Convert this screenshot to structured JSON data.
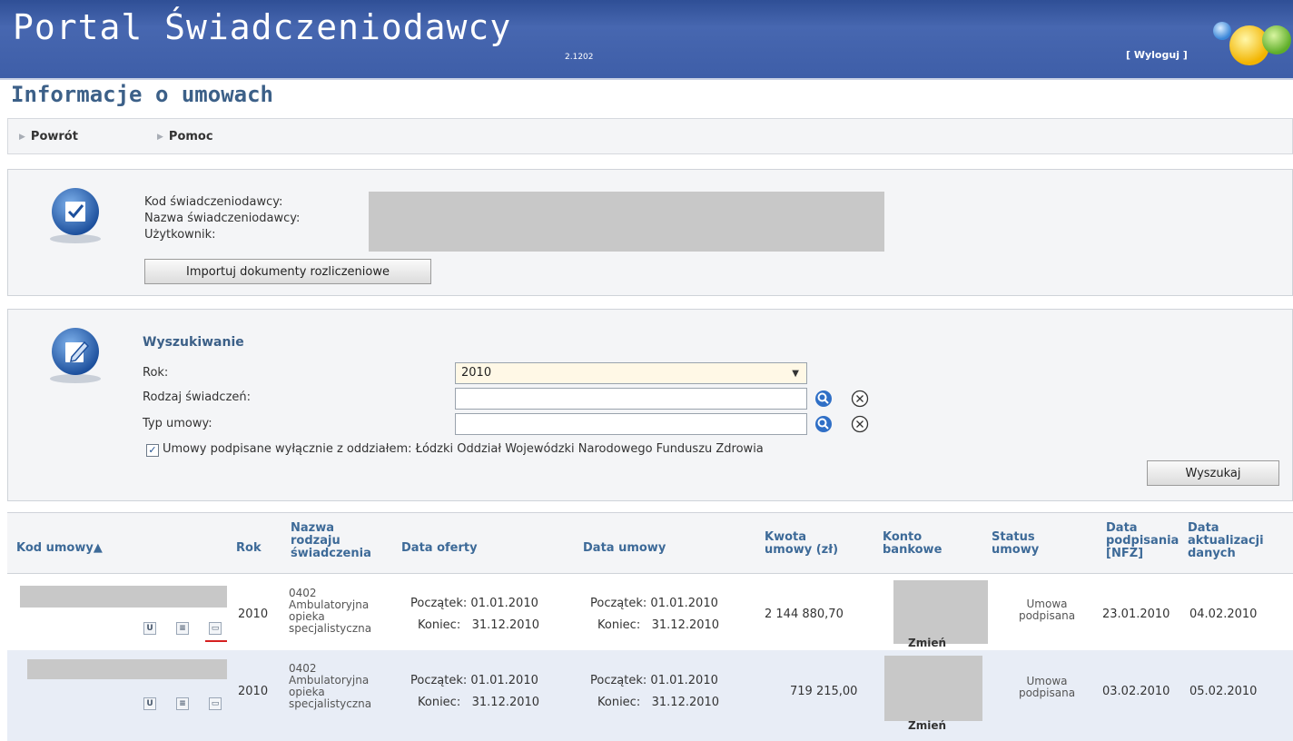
{
  "app": {
    "title": "Portal Świadczeniodawcy",
    "version": "2.1202",
    "logout_label": "[ Wyloguj ]",
    "page_title": "Informacje o umowach"
  },
  "nav": {
    "back_label": "Powrót",
    "help_label": "Pomoc"
  },
  "provider": {
    "code_label": "Kod świadczeniodawcy:",
    "name_label": "Nazwa świadczeniodawcy:",
    "user_label": "Użytkownik:",
    "import_button": "Importuj dokumenty rozliczeniowe"
  },
  "search": {
    "heading": "Wyszukiwanie",
    "year_label": "Rok:",
    "year_value": "2010",
    "service_type_label": "Rodzaj świadczeń:",
    "service_type_value": "",
    "contract_type_label": "Typ umowy:",
    "contract_type_value": "",
    "branch_checkbox_checked": true,
    "branch_checkbox_label": "Umowy podpisane wyłącznie z oddziałem: Łódzki Oddział Wojewódzki Narodowego Funduszu Zdrowia",
    "search_button": "Wyszukaj"
  },
  "table": {
    "headers": {
      "code": "Kod umowy▲",
      "year": "Rok",
      "service_name_1": "Nazwa",
      "service_name_2": "rodzaju",
      "service_name_3": "świadczenia",
      "offer_date": "Data oferty",
      "contract_date": "Data umowy",
      "amount_1": "Kwota",
      "amount_2": "umowy (zł)",
      "account_1": "Konto",
      "account_2": "bankowe",
      "status_1": "Status",
      "status_2": "umowy",
      "signed_1": "Data",
      "signed_2": "podpisania",
      "signed_3": "[NFZ]",
      "updated_1": "Data",
      "updated_2": "aktualizacji",
      "updated_3": "danych"
    },
    "row_icons": [
      "U",
      "≡",
      "▭"
    ],
    "rows": [
      {
        "year": "2010",
        "service_line1": "0402",
        "service_line2": "Ambulatoryjna",
        "service_line3": "opieka",
        "service_line4": "specjalistyczna",
        "offer_start_label": "Początek:",
        "offer_start": "01.01.2010",
        "offer_end_label": "Koniec:",
        "offer_end": "31.12.2010",
        "contract_start_label": "Początek:",
        "contract_start": "01.01.2010",
        "contract_end_label": "Koniec:",
        "contract_end": "31.12.2010",
        "amount": "2 144 880,70",
        "account_change": "Zmień",
        "status_line1": "Umowa",
        "status_line2": "podpisana",
        "signed_date": "23.01.2010",
        "updated_date": "04.02.2010"
      },
      {
        "year": "2010",
        "service_line1": "0402",
        "service_line2": "Ambulatoryjna",
        "service_line3": "opieka",
        "service_line4": "specjalistyczna",
        "offer_start_label": "Początek:",
        "offer_start": "01.01.2010",
        "offer_end_label": "Koniec:",
        "offer_end": "31.12.2010",
        "contract_start_label": "Początek:",
        "contract_start": "01.01.2010",
        "contract_end_label": "Koniec:",
        "contract_end": "31.12.2010",
        "amount": "719 215,00",
        "account_change": "Zmień",
        "status_line1": "Umowa",
        "status_line2": "podpisana",
        "signed_date": "03.02.2010",
        "updated_date": "05.02.2010"
      }
    ]
  },
  "colors": {
    "header_blue": "#3e5ea8",
    "title_blue": "#3c6088",
    "header_link_blue": "#3d6a98",
    "row_alt": "#e8edf6",
    "highlight_red": "#d62020"
  }
}
